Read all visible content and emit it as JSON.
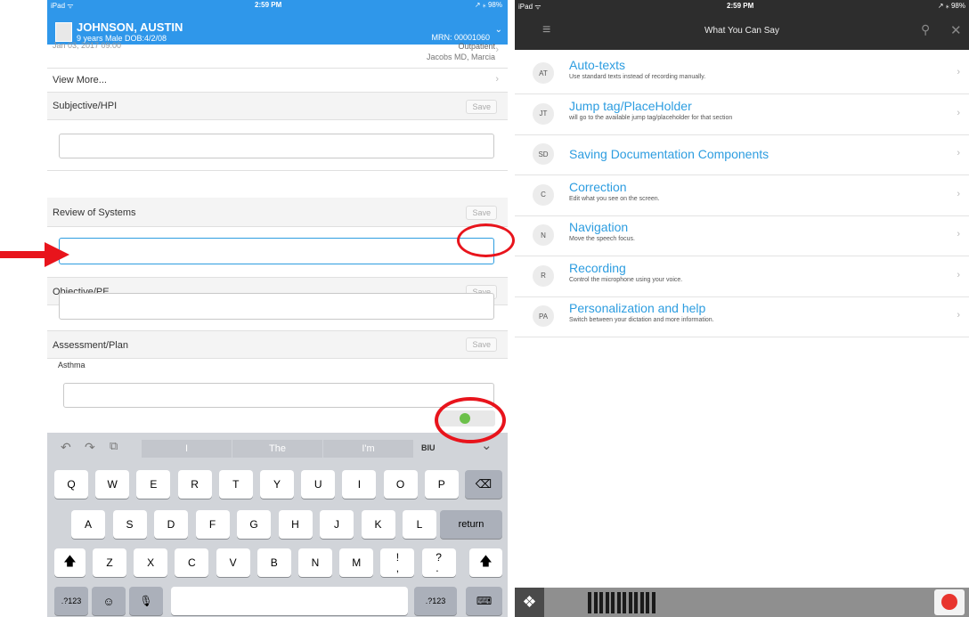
{
  "left": {
    "status": {
      "device": "iPad ᯤ",
      "time": "2:59 PM",
      "battery": "↗ ⁎ 98%"
    },
    "patient": {
      "name": "JOHNSON, AUSTIN",
      "info": "9 years  Male  DOB:4/2/08",
      "mrn": "MRN: 00001060"
    },
    "visit_partial": "Jan 03, 2017 09:00",
    "visit_type": "Outpatient",
    "provider": "Jacobs MD, Marcia",
    "view_more": "View More...",
    "sections": [
      {
        "label": "Subjective/HPI",
        "save": "Save",
        "value": ""
      },
      {
        "label": "Review of Systems",
        "save": "Save",
        "value": ""
      },
      {
        "label": "Objective/PE",
        "save": "Save",
        "value": ""
      },
      {
        "label": "Assessment/Plan",
        "save": "Save",
        "value": "Asthma"
      }
    ],
    "keyboard": {
      "suggestions": [
        "I",
        "The",
        "I'm"
      ],
      "format": "BIU",
      "row1": [
        "Q",
        "W",
        "E",
        "R",
        "T",
        "Y",
        "U",
        "I",
        "O",
        "P"
      ],
      "row2": [
        "A",
        "S",
        "D",
        "F",
        "G",
        "H",
        "J",
        "K",
        "L"
      ],
      "row3": [
        "Z",
        "X",
        "C",
        "V",
        "B",
        "N",
        "M",
        "!\n,",
        "?\n."
      ],
      "return": "return",
      "num": ".?123"
    }
  },
  "right": {
    "status": {
      "device": "iPad ᯤ",
      "time": "2:59 PM",
      "battery": "↗ ⁎ 98%"
    },
    "title": "What You Can Say",
    "commands": [
      {
        "badge": "AT",
        "title": "Auto-texts",
        "subtitle": "Use standard texts instead of recording manually."
      },
      {
        "badge": "JT",
        "title": "Jump tag/PlaceHolder",
        "subtitle": "will go to the available jump tag/placeholder for that section"
      },
      {
        "badge": "SD",
        "title": "Saving Documentation Components",
        "subtitle": ""
      },
      {
        "badge": "C",
        "title": "Correction",
        "subtitle": "Edit what you see on the screen."
      },
      {
        "badge": "N",
        "title": "Navigation",
        "subtitle": "Move the speech focus."
      },
      {
        "badge": "R",
        "title": "Recording",
        "subtitle": "Control the microphone using your voice."
      },
      {
        "badge": "PA",
        "title": "Personalization and help",
        "subtitle": "Switch between your dictation and more information."
      }
    ]
  },
  "colors": {
    "header_blue": "#2f97ea",
    "link_blue": "#2d9de0",
    "annotation_red": "#e8141c",
    "mic_green": "#6cc04a",
    "mic_red": "#e8352e"
  }
}
